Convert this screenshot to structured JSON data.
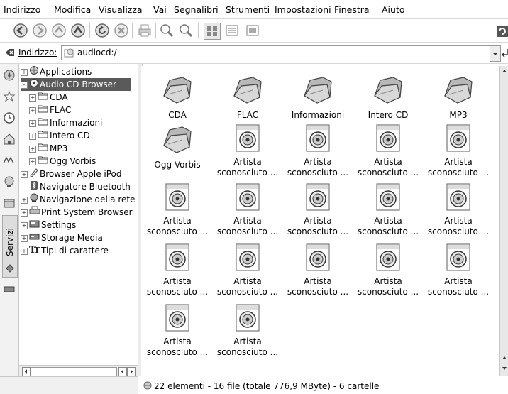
{
  "menubar": {
    "items": [
      "Indirizzo",
      "Modifica",
      "Visualizza",
      "Vai",
      "Segnalibri",
      "Strumenti",
      "Impostazioni",
      "Finestra",
      "Aiuto"
    ]
  },
  "toolbar": {
    "icons": [
      "back-icon",
      "forward-icon",
      "up-icon",
      "home-icon",
      "reload-icon",
      "stop-icon",
      "print-icon",
      "zoom-in-icon",
      "zoom-out-icon",
      "icon-view-icon",
      "detail-view-icon",
      "preview-icon"
    ]
  },
  "location": {
    "label": "Indirizzo:",
    "value": "audiocd:/"
  },
  "sidebar_tabs": {
    "label": "Servizi",
    "icons": [
      "navigation-icon",
      "bookmarks-icon",
      "history-icon",
      "home-folder-icon",
      "media-icon",
      "network-icon",
      "root-folder-icon",
      "services-icon",
      "storage-icon"
    ]
  },
  "tree": {
    "items": [
      {
        "label": "Applications",
        "level": 0,
        "expander": "+",
        "icon": "globe-icon"
      },
      {
        "label": "Audio CD Browser",
        "level": 0,
        "expander": "-",
        "icon": "cd-icon",
        "selected": true
      },
      {
        "label": "CDA",
        "level": 1,
        "expander": "+",
        "icon": "folder-icon"
      },
      {
        "label": "FLAC",
        "level": 1,
        "expander": "+",
        "icon": "folder-icon"
      },
      {
        "label": "Informazioni",
        "level": 1,
        "expander": "+",
        "icon": "folder-icon"
      },
      {
        "label": "Intero CD",
        "level": 1,
        "expander": "+",
        "icon": "folder-icon"
      },
      {
        "label": "MP3",
        "level": 1,
        "expander": "+",
        "icon": "folder-icon"
      },
      {
        "label": "Ogg Vorbis",
        "level": 1,
        "expander": "+",
        "icon": "folder-icon"
      },
      {
        "label": "Browser Apple iPod",
        "level": 0,
        "expander": "+",
        "icon": "ipod-icon"
      },
      {
        "label": "Navigatore Bluetooth",
        "level": 0,
        "expander": "",
        "icon": "bluetooth-icon"
      },
      {
        "label": "Navigazione della rete",
        "level": 0,
        "expander": "+",
        "icon": "network-icon"
      },
      {
        "label": "Print System Browser",
        "level": 0,
        "expander": "+",
        "icon": "printer-icon"
      },
      {
        "label": "Settings",
        "level": 0,
        "expander": "+",
        "icon": "settings-icon"
      },
      {
        "label": "Storage Media",
        "level": 0,
        "expander": "+",
        "icon": "storage-icon"
      },
      {
        "label": "Tipi di carattere",
        "level": 0,
        "expander": "+",
        "icon": "font-icon"
      }
    ]
  },
  "main": {
    "items": [
      {
        "label": "CDA",
        "type": "folder"
      },
      {
        "label": "FLAC",
        "type": "folder"
      },
      {
        "label": "Informazioni",
        "type": "folder"
      },
      {
        "label": "Intero CD",
        "type": "folder"
      },
      {
        "label": "MP3",
        "type": "folder"
      },
      {
        "label": "Ogg Vorbis",
        "type": "folder"
      },
      {
        "label": "Artista sconosciuto ...",
        "type": "audio"
      },
      {
        "label": "Artista sconosciuto ...",
        "type": "audio"
      },
      {
        "label": "Artista sconosciuto ...",
        "type": "audio"
      },
      {
        "label": "Artista sconosciuto ...",
        "type": "audio"
      },
      {
        "label": "Artista sconosciuto ...",
        "type": "audio"
      },
      {
        "label": "Artista sconosciuto ...",
        "type": "audio"
      },
      {
        "label": "Artista sconosciuto ...",
        "type": "audio"
      },
      {
        "label": "Artista sconosciuto ...",
        "type": "audio"
      },
      {
        "label": "Artista sconosciuto ...",
        "type": "audio"
      },
      {
        "label": "Artista sconosciuto ...",
        "type": "audio"
      },
      {
        "label": "Artista sconosciuto ...",
        "type": "audio"
      },
      {
        "label": "Artista sconosciuto ...",
        "type": "audio"
      },
      {
        "label": "Artista sconosciuto ...",
        "type": "audio"
      },
      {
        "label": "Artista sconosciuto ...",
        "type": "audio"
      },
      {
        "label": "Artista sconosciuto ...",
        "type": "audio"
      },
      {
        "label": "Artista sconosciuto ...",
        "type": "audio"
      }
    ]
  },
  "status": {
    "text": "22 elementi - 16 file (totale 776,9 MByte) - 6 cartelle"
  },
  "colors": {
    "selection": "#5a5a5a",
    "folder": "#9a9a9a",
    "background": "#ffffff"
  }
}
